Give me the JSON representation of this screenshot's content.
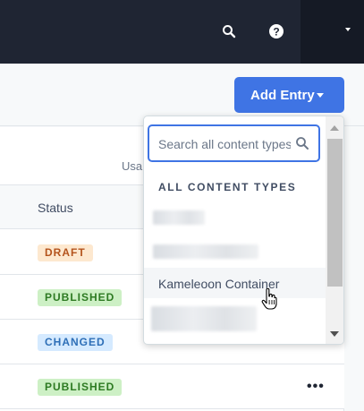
{
  "topbar": {
    "search_icon": "search-icon",
    "help_icon": "help-circle-icon",
    "account_caret_icon": "caret-down-icon"
  },
  "toolbar": {
    "add_entry_label": "Add Entry",
    "add_entry_color": "#3f74e4"
  },
  "table": {
    "usage_label": "Usa",
    "status_header": "Status",
    "rows": [
      {
        "status": "DRAFT"
      },
      {
        "status": "PUBLISHED"
      },
      {
        "status": "CHANGED"
      },
      {
        "status": "PUBLISHED",
        "actions": "•••"
      }
    ]
  },
  "dropdown": {
    "search_placeholder": "Search all content types",
    "section_heading": "ALL CONTENT TYPES",
    "items": [
      {
        "label": "",
        "obscured": true
      },
      {
        "label": "",
        "obscured": true
      },
      {
        "label": "Kameleoon Container",
        "obscured": false,
        "hovered": true
      },
      {
        "label": "",
        "obscured": true
      }
    ]
  },
  "colors": {
    "topbar_bg": "#1f2533",
    "draft_badge": "#fde8cf",
    "published_badge": "#cdf0c5",
    "changed_badge": "#d5eaff"
  }
}
